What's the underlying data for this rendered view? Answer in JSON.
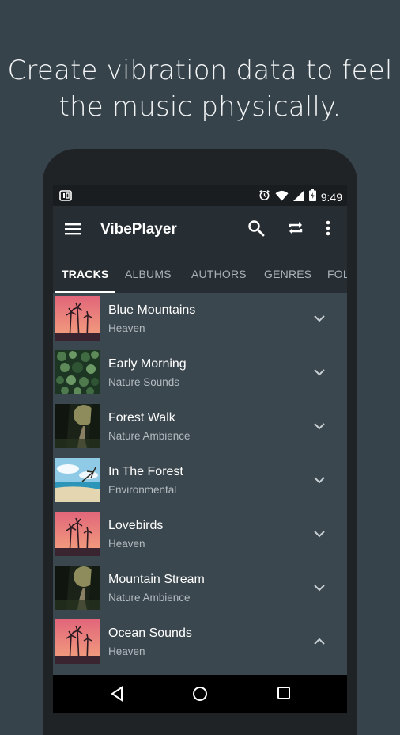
{
  "headline": {
    "line1": "Create vibration data to feel",
    "line2": "the music physically."
  },
  "status_bar": {
    "time": "9:49",
    "icons": [
      "notification-icon",
      "alarm-icon",
      "wifi-icon",
      "signal-icon",
      "battery-icon"
    ]
  },
  "app_bar": {
    "title": "VibePlayer",
    "icons": [
      "menu-icon",
      "search-icon",
      "repeat-icon",
      "more-vert-icon"
    ]
  },
  "tabs": [
    {
      "label": "TRACKS",
      "active": true
    },
    {
      "label": "ALBUMS",
      "active": false
    },
    {
      "label": "AUTHORS",
      "active": false
    },
    {
      "label": "GENRES",
      "active": false
    },
    {
      "label": "FOL",
      "active": false
    }
  ],
  "tracks": [
    {
      "title": "Blue Mountains",
      "subtitle": "Heaven",
      "expanded": false
    },
    {
      "title": "Early Morning",
      "subtitle": "Nature Sounds",
      "expanded": false
    },
    {
      "title": "Forest Walk",
      "subtitle": "Nature Ambience",
      "expanded": false
    },
    {
      "title": "In The Forest",
      "subtitle": "Environmental",
      "expanded": false
    },
    {
      "title": "Lovebirds",
      "subtitle": "Heaven",
      "expanded": false
    },
    {
      "title": "Mountain Stream",
      "subtitle": "Nature Ambience",
      "expanded": false
    },
    {
      "title": "Ocean Sounds",
      "subtitle": "Heaven",
      "expanded": true
    }
  ],
  "nav_bar": {
    "icons": [
      "back-icon",
      "home-icon",
      "recents-icon"
    ]
  },
  "colors": {
    "background": "#36434b",
    "app_bar": "#272e33",
    "list_background": "#3b474e",
    "text_primary": "#ffffff",
    "text_secondary": "#b3bcc1"
  }
}
